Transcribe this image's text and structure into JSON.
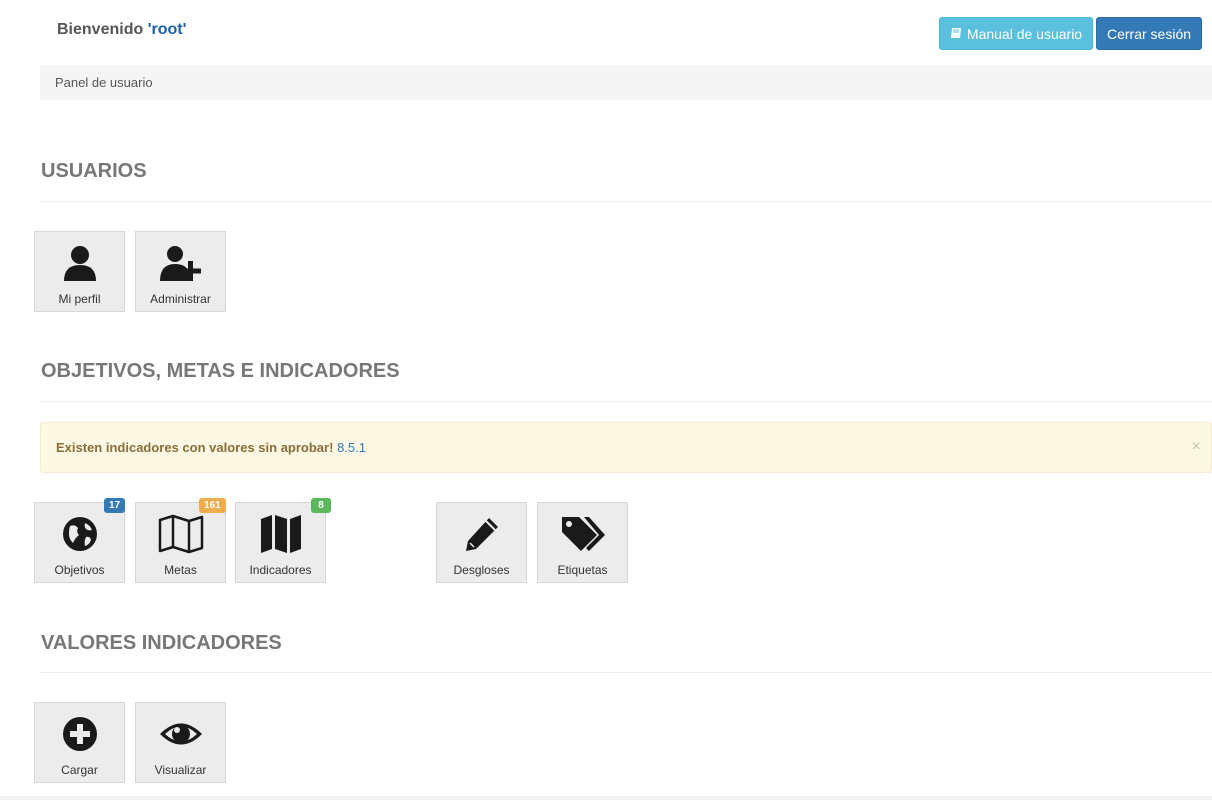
{
  "header": {
    "welcome_prefix": "Bienvenido ",
    "username": "'root'",
    "manual_label": "Manual de usuario",
    "logout_label": "Cerrar sesión"
  },
  "breadcrumb": "Panel de usuario",
  "sections": {
    "usuarios": {
      "title": "USUARIOS",
      "tiles": [
        {
          "label": "Mi perfil",
          "icon": "user-icon"
        },
        {
          "label": "Administrar",
          "icon": "user-add-icon"
        }
      ]
    },
    "objetivos": {
      "title": "OBJETIVOS, METAS E INDICADORES",
      "alert": {
        "message": "Existen indicadores con valores sin aprobar!",
        "link": "8.5.1",
        "close": "×"
      },
      "tiles": [
        {
          "label": "Objetivos",
          "icon": "globe-icon",
          "badge": "17",
          "badge_color": "#337ab7"
        },
        {
          "label": "Metas",
          "icon": "map-outline-icon",
          "badge": "161",
          "badge_color": "#f0ad4e"
        },
        {
          "label": "Indicadores",
          "icon": "map-solid-icon",
          "badge": "8",
          "badge_color": "#5cb85c"
        },
        {
          "label": "Desgloses",
          "icon": "pencil-icon"
        },
        {
          "label": "Etiquetas",
          "icon": "tags-icon"
        }
      ]
    },
    "valores": {
      "title": "VALORES INDICADORES",
      "tiles": [
        {
          "label": "Cargar",
          "icon": "plus-circle-icon"
        },
        {
          "label": "Visualizar",
          "icon": "eye-icon"
        }
      ]
    }
  },
  "colors": {
    "info": "#5bc0de",
    "primary": "#337ab7",
    "warning_bg": "#fcf8e3"
  }
}
